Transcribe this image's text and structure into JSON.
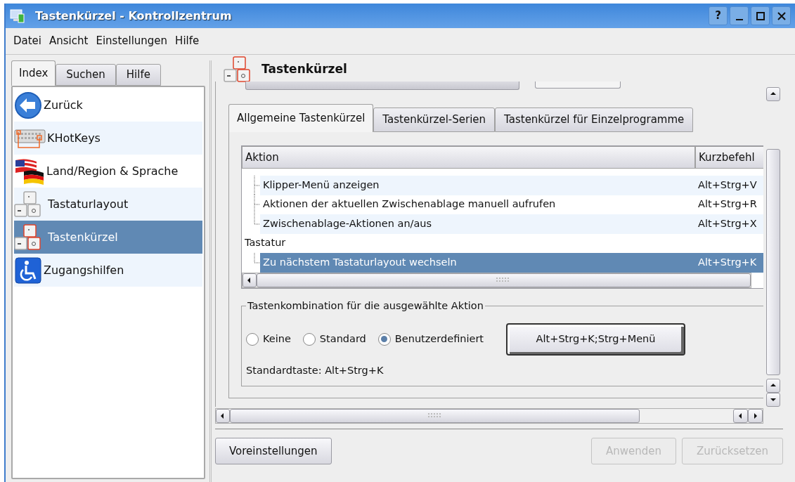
{
  "window": {
    "title": "Tastenkürzel - Kontrollzentrum",
    "help_button": "?"
  },
  "menu": [
    {
      "label": "Datei"
    },
    {
      "label": "Ansicht"
    },
    {
      "label": "Einstellungen"
    },
    {
      "label": "Hilfe"
    }
  ],
  "sidebar": {
    "tabs": [
      {
        "label": "Index",
        "selected": true
      },
      {
        "label": "Suchen",
        "selected": false
      },
      {
        "label": "Hilfe",
        "selected": false
      }
    ],
    "items": [
      {
        "label": "Zurück",
        "kind": "back",
        "selected": false
      },
      {
        "label": "KHotKeys",
        "kind": "keyboard",
        "selected": false
      },
      {
        "label": "Land/Region & Sprache",
        "kind": "flags",
        "selected": false
      },
      {
        "label": "Tastaturlayout",
        "kind": "keys",
        "selected": false
      },
      {
        "label": "Tastenkürzel",
        "kind": "keys-red",
        "selected": true
      },
      {
        "label": "Zugangshilfen",
        "kind": "wheelchair",
        "selected": false
      }
    ]
  },
  "module": {
    "title": "Tastenkürzel"
  },
  "tabs": [
    {
      "label": "Allgemeine Tastenkürzel",
      "selected": true
    },
    {
      "label": "Tastenkürzel-Serien",
      "selected": false
    },
    {
      "label": "Tastenkürzel für Einzelprogramme",
      "selected": false
    }
  ],
  "table": {
    "columns": [
      "Aktion",
      "Kurzbefehl"
    ],
    "tree": [
      {
        "children": [
          {
            "action": "Klipper-Menü anzeigen",
            "shortcut": "Alt+Strg+V",
            "selected": false
          },
          {
            "action": "Aktionen der aktuellen Zwischenablage manuell aufrufen",
            "shortcut": "Alt+Strg+R",
            "selected": false
          },
          {
            "action": "Zwischenablage-Aktionen an/aus",
            "shortcut": "Alt+Strg+X",
            "selected": false
          }
        ]
      },
      {
        "action": "Tastatur",
        "children": [
          {
            "action": "Zu nächstem Tastaturlayout wechseln",
            "shortcut": "Alt+Strg+K",
            "selected": true
          }
        ]
      }
    ]
  },
  "shortcut_group": {
    "title": "Tastenkombination für die ausgewählte Aktion",
    "options": [
      {
        "label": "Keine",
        "selected": false
      },
      {
        "label": "Standard",
        "selected": false
      },
      {
        "label": "Benutzerdefiniert",
        "selected": true
      }
    ],
    "key_button": "Alt+Strg+K;Strg+Menü",
    "default_key": "Standardtaste: Alt+Strg+K"
  },
  "buttons": [
    {
      "label": "Voreinstellungen",
      "disabled": false
    },
    {
      "label": "Anwenden",
      "disabled": true
    },
    {
      "label": "Zurücksetzen",
      "disabled": true
    }
  ]
}
